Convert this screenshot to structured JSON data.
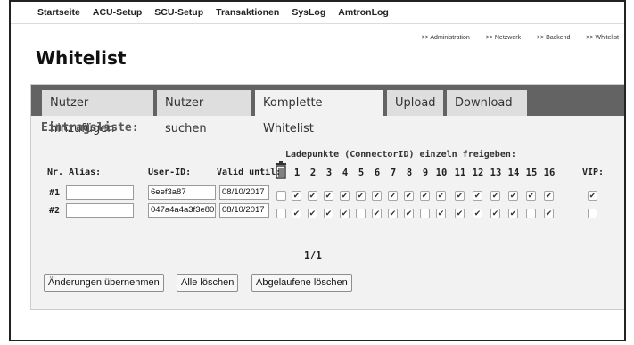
{
  "top_nav": [
    "Startseite",
    "ACU-Setup",
    "SCU-Setup",
    "Transaktionen",
    "SysLog",
    "AmtronLog"
  ],
  "breadcrumb": [
    ">> Administration",
    ">> Netzwerk",
    ">> Backend",
    ">> Whitelist"
  ],
  "page_title": "Whitelist",
  "tabs": [
    "Nutzer hinzufügen",
    "Nutzer suchen",
    "Komplette Whitelist",
    "Upload",
    "Download"
  ],
  "active_tab": "Komplette Whitelist",
  "section_label": "Eintragsliste:",
  "ladepunkte_label": "Ladepunkte (ConnectorID) einzeln freigeben:",
  "columns": {
    "nr_alias": "Nr. Alias:",
    "user_id": "User-ID:",
    "valid_until": "Valid until:",
    "vip": "VIP:"
  },
  "connector_numbers": [
    "1",
    "2",
    "3",
    "4",
    "5",
    "6",
    "7",
    "8",
    "9",
    "10",
    "11",
    "12",
    "13",
    "14",
    "15",
    "16"
  ],
  "rows": [
    {
      "nr": "#1",
      "alias": "",
      "user_id": "6eef3a87",
      "valid_until": "08/10/2017",
      "delete": false,
      "connectors": [
        true,
        true,
        true,
        true,
        true,
        true,
        true,
        true,
        true,
        true,
        true,
        true,
        true,
        true,
        true,
        true
      ],
      "vip": true
    },
    {
      "nr": "#2",
      "alias": "",
      "user_id": "047a4a4a3f3e80",
      "valid_until": "08/10/2017",
      "delete": false,
      "connectors": [
        true,
        true,
        true,
        true,
        false,
        true,
        true,
        true,
        false,
        true,
        true,
        true,
        true,
        true,
        false,
        true
      ],
      "vip": false
    }
  ],
  "pager": "1/1",
  "buttons": {
    "apply": "Änderungen übernehmen",
    "delete_all": "Alle löschen",
    "delete_expired": "Abgelaufene löschen"
  },
  "icons": {
    "trash": "trash-icon"
  }
}
